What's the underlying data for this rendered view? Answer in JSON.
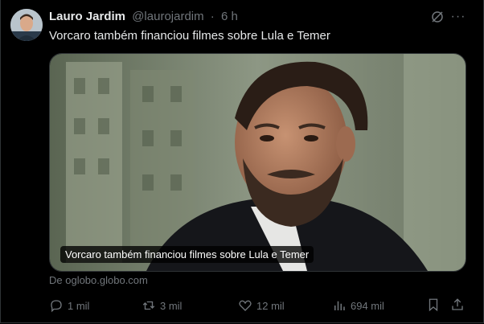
{
  "tweet": {
    "author_name": "Lauro Jardim",
    "handle": "@laurojardim",
    "separator": "·",
    "time": "6 h",
    "text": "Vorcaro também financiou filmes sobre Lula e Temer",
    "more_label": "···"
  },
  "card": {
    "caption": "Vorcaro também financiou filmes sobre Lula e Temer",
    "source": "De oglobo.globo.com"
  },
  "actions": {
    "replies": "1 mil",
    "reposts": "3 mil",
    "likes": "12 mil",
    "views": "694 mil"
  },
  "colors": {
    "background": "#000000",
    "text_primary": "#e7e9ea",
    "text_secondary": "#71767b",
    "border": "#2f3336"
  }
}
